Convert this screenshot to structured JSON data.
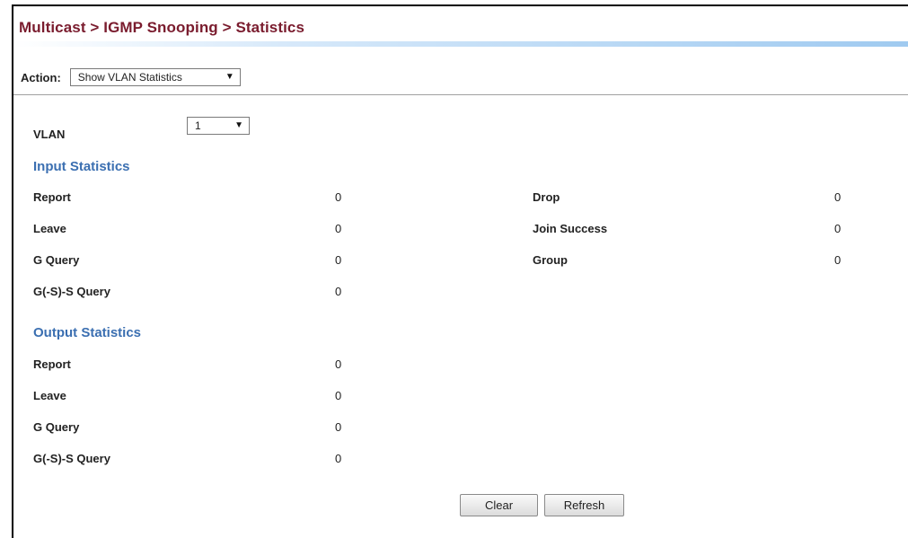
{
  "header": {
    "breadcrumb": "Multicast > IGMP Snooping > Statistics"
  },
  "action": {
    "label": "Action:",
    "selected": "Show VLAN Statistics"
  },
  "vlan": {
    "label": "VLAN",
    "selected": "1"
  },
  "input_statistics": {
    "title": "Input Statistics",
    "left": [
      {
        "label": "Report",
        "value": "0"
      },
      {
        "label": "Leave",
        "value": "0"
      },
      {
        "label": "G Query",
        "value": "0"
      },
      {
        "label": "G(-S)-S Query",
        "value": "0"
      }
    ],
    "right": [
      {
        "label": "Drop",
        "value": "0"
      },
      {
        "label": "Join Success",
        "value": "0"
      },
      {
        "label": "Group",
        "value": "0"
      }
    ]
  },
  "output_statistics": {
    "title": "Output Statistics",
    "rows": [
      {
        "label": "Report",
        "value": "0"
      },
      {
        "label": "Leave",
        "value": "0"
      },
      {
        "label": "G Query",
        "value": "0"
      },
      {
        "label": "G(-S)-S Query",
        "value": "0"
      }
    ]
  },
  "buttons": {
    "clear": "Clear",
    "refresh": "Refresh"
  }
}
